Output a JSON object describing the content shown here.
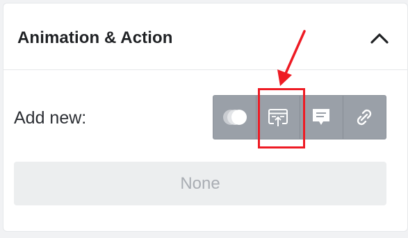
{
  "panel": {
    "title": "Animation & Action",
    "collapse_icon": "chevron-up-icon"
  },
  "add_new": {
    "label": "Add new:",
    "buttons": [
      {
        "name": "animation",
        "icon": "overlapping-circles-icon"
      },
      {
        "name": "popup",
        "icon": "window-popup-icon"
      },
      {
        "name": "tooltip",
        "icon": "speech-bubble-icon"
      },
      {
        "name": "link",
        "icon": "link-icon"
      }
    ]
  },
  "current_action": {
    "value": "None"
  },
  "annotation": {
    "color": "#ee1b24",
    "highlighted_button": "popup"
  }
}
